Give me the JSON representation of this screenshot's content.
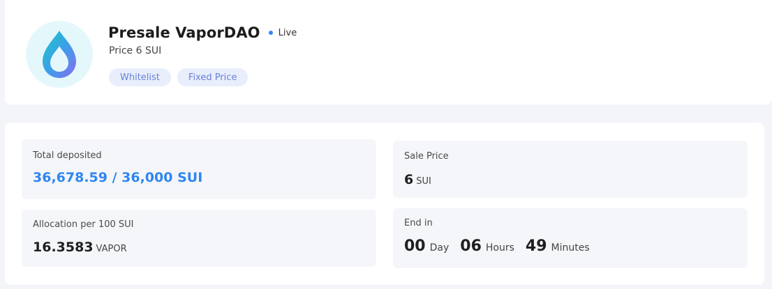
{
  "project": {
    "title": "Presale VaporDAO",
    "status": "Live",
    "price_label": "Price",
    "price_value": "6 SUI",
    "badges": [
      "Whitelist",
      "Fixed Price"
    ]
  },
  "stats": {
    "total_deposited": {
      "label": "Total deposited",
      "value": "36,678.59 / 36,000 SUI"
    },
    "sale_price": {
      "label": "Sale Price",
      "value": "6",
      "unit": "SUI"
    },
    "allocation": {
      "label": "Allocation per 100 SUI",
      "value": "16.3583",
      "unit": "VAPOR"
    },
    "end_in": {
      "label": "End in",
      "days": "00",
      "days_unit": "Day",
      "hours": "06",
      "hours_unit": "Hours",
      "minutes": "49",
      "minutes_unit": "Minutes"
    }
  },
  "colors": {
    "accent": "#2f86f3",
    "badge_bg": "#e8eefc",
    "badge_text": "#6a82d8"
  }
}
